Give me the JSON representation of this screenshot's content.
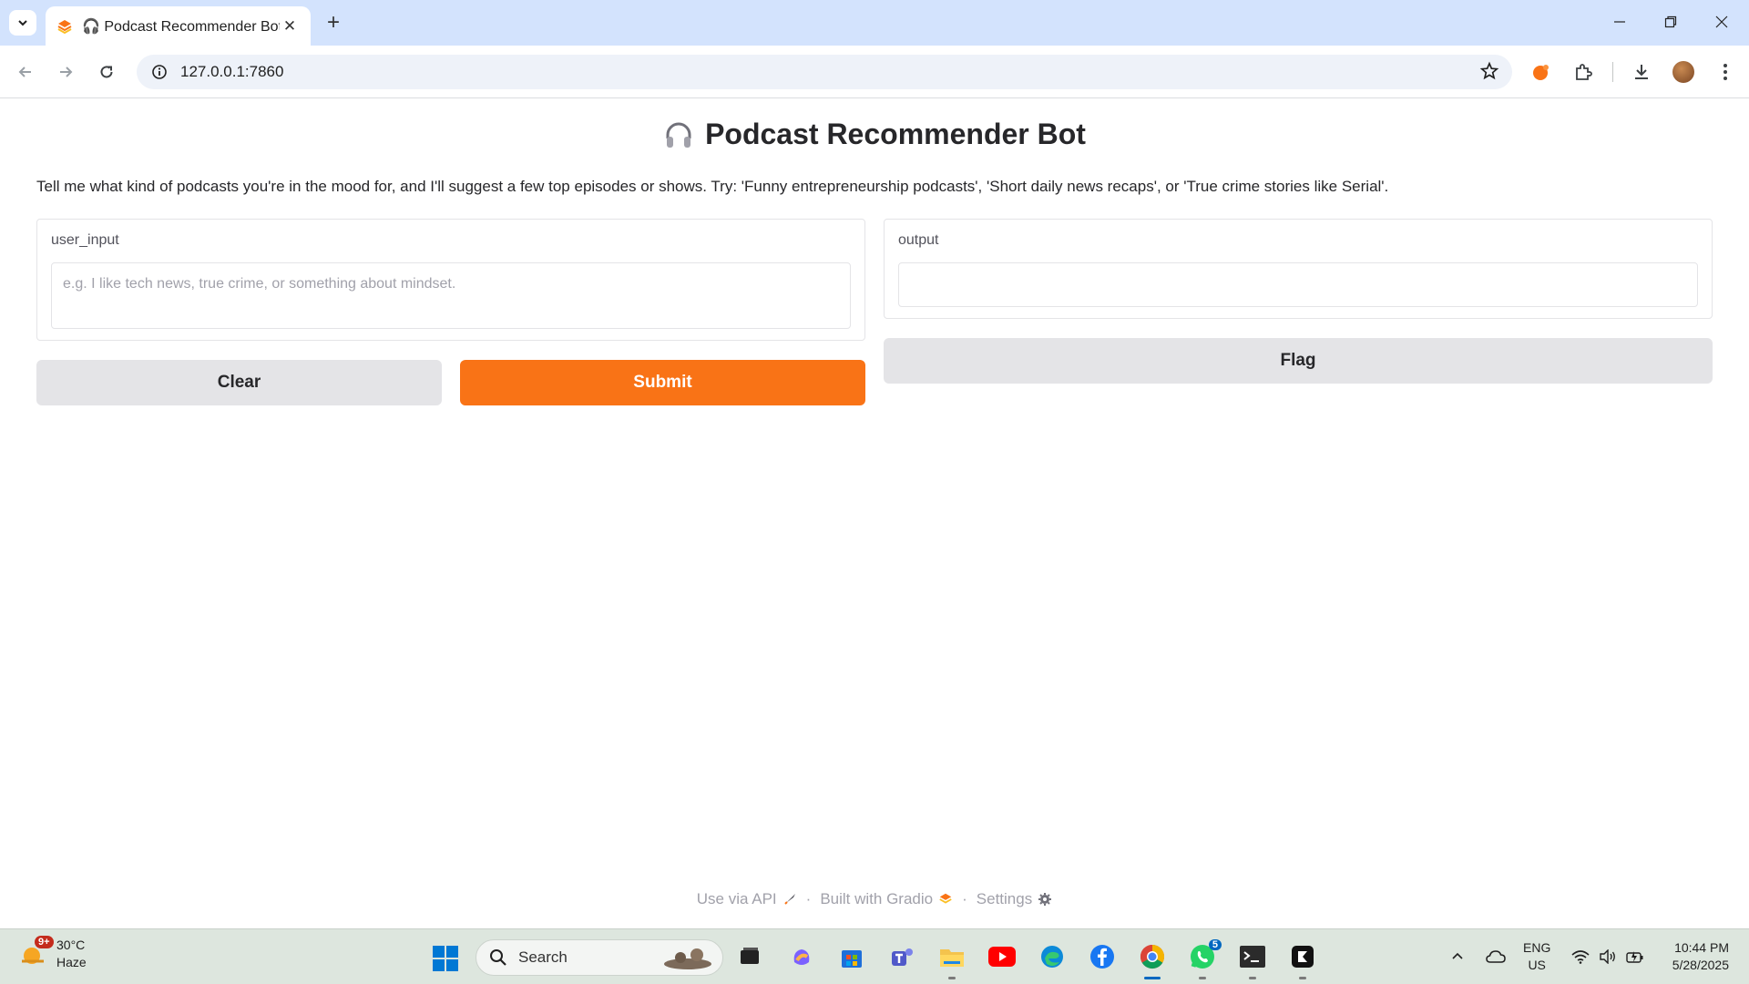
{
  "browser": {
    "tab_title": "🎧 Podcast Recommender Bot",
    "url": "127.0.0.1:7860",
    "new_tab": "+",
    "tab_close": "✕"
  },
  "page": {
    "title": "Podcast Recommender Bot",
    "description": "Tell me what kind of podcasts you're in the mood for, and I'll suggest a few top episodes or shows. Try: 'Funny entrepreneurship podcasts', 'Short daily news recaps', or 'True crime stories like Serial'.",
    "input_label": "user_input",
    "input_placeholder": "e.g. I like tech news, true crime, or something about mindset.",
    "input_value": "",
    "output_label": "output",
    "output_value": "",
    "clear_label": "Clear",
    "submit_label": "Submit",
    "flag_label": "Flag",
    "accent_color": "#f97316"
  },
  "footer": {
    "api": "Use via API",
    "built": "Built with Gradio",
    "settings": "Settings",
    "separator": "·"
  },
  "taskbar": {
    "weather_badge": "9+",
    "temperature": "30°C",
    "condition": "Haze",
    "search": "Search",
    "whatsapp_badge": "5",
    "lang_top": "ENG",
    "lang_bottom": "US",
    "time": "10:44 PM",
    "date": "5/28/2025"
  }
}
